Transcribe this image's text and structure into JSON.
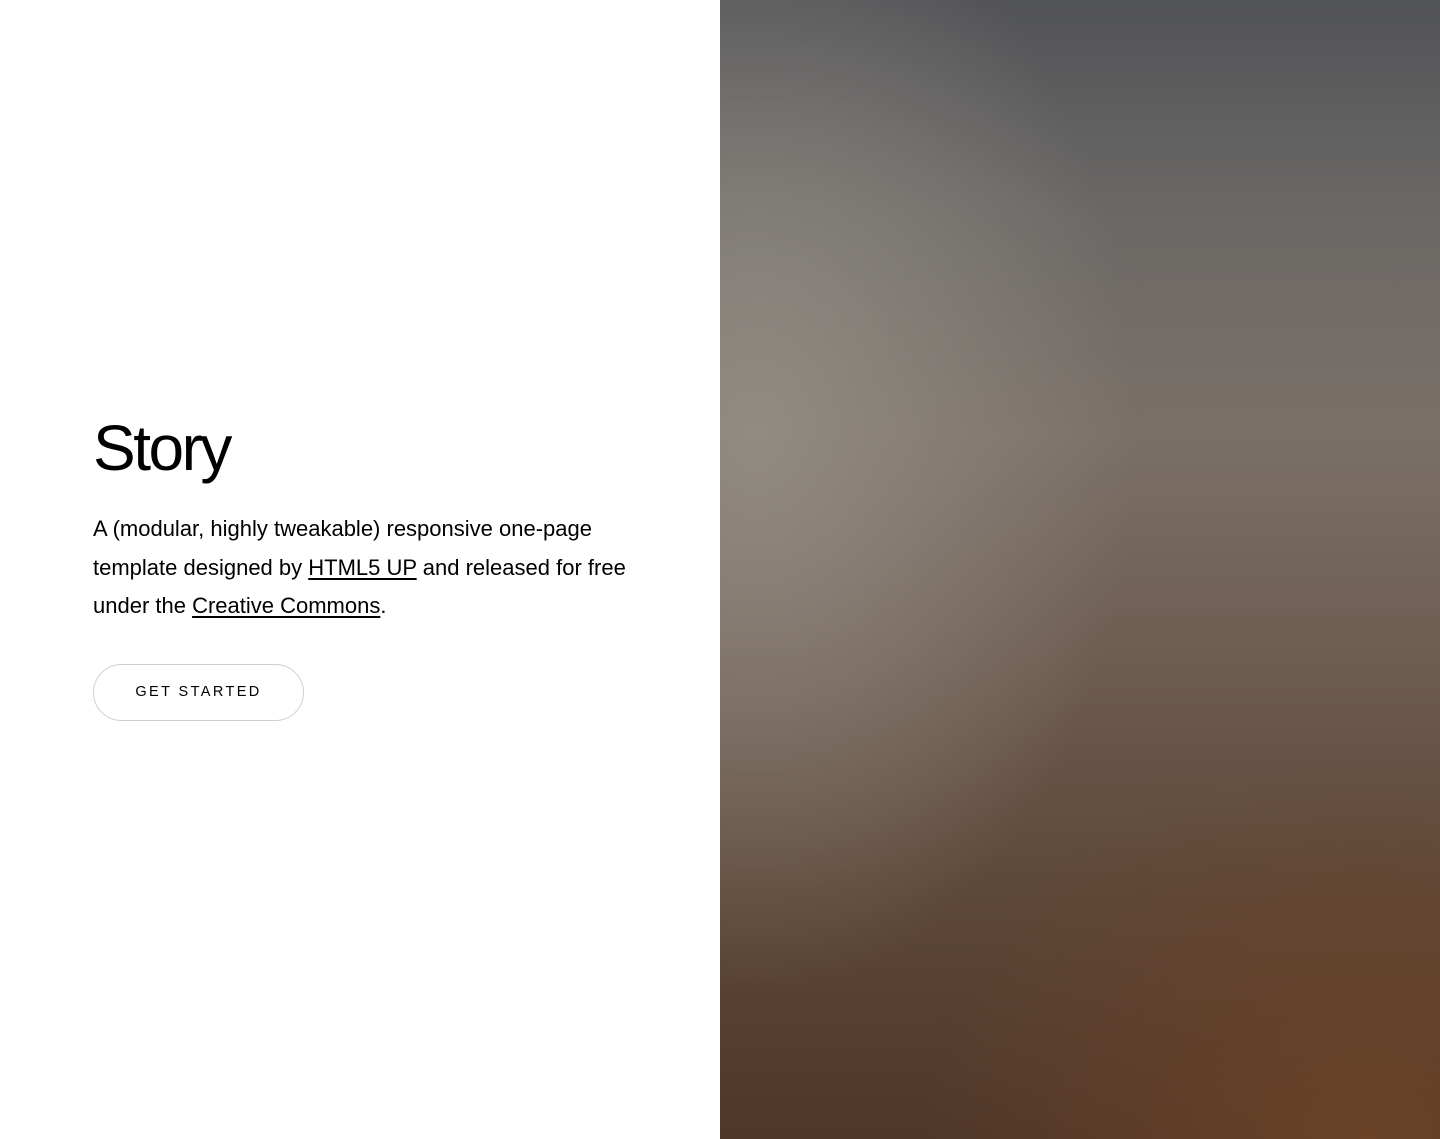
{
  "banner": {
    "title": "Story",
    "description": {
      "part1": "A (modular, highly tweakable) responsive one-page template designed by ",
      "link1": "HTML5 UP",
      "part2": " and released for free under the ",
      "link2": "Creative Commons",
      "part3": "."
    },
    "button_label": "GET STARTED"
  },
  "colors": {
    "text": "#000000",
    "background": "#ffffff",
    "button_border": "#cfcfcf",
    "image_tone_top": "#525357",
    "image_tone_bottom": "#4e3628"
  }
}
